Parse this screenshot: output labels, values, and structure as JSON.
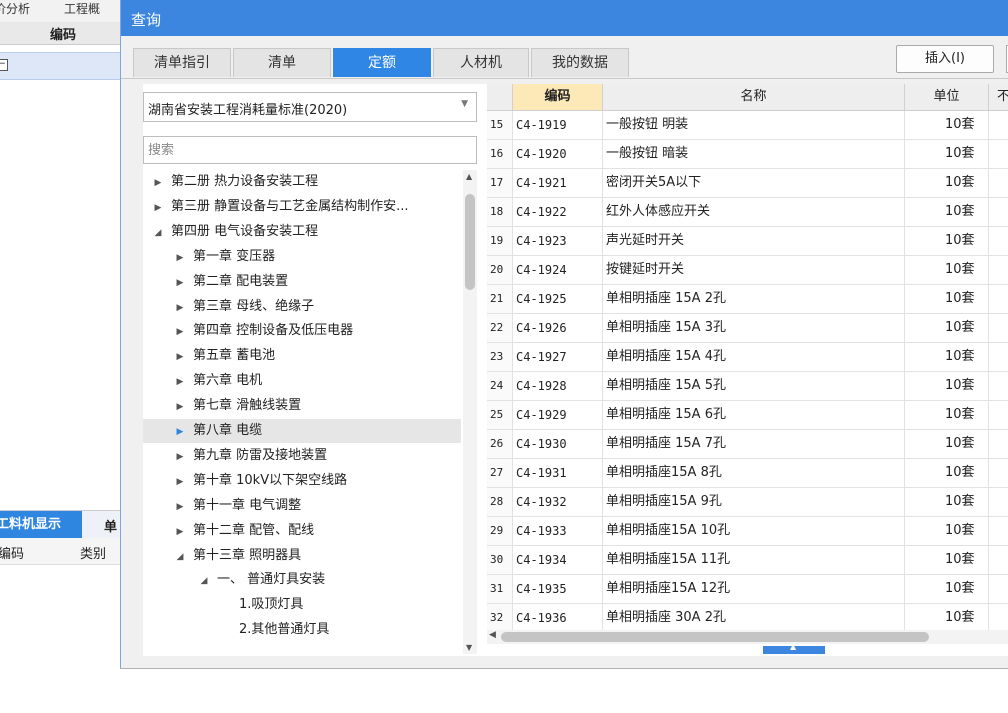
{
  "background_app": {
    "tabs": [
      "价分析",
      "工程概"
    ],
    "column_header": "编码",
    "bottom_tabs": [
      "工料机显示",
      "单"
    ],
    "bottom_columns": [
      "编码",
      "类别"
    ]
  },
  "dialog": {
    "title": "查询",
    "tabs": [
      {
        "label": "清单指引",
        "active": false
      },
      {
        "label": "清单",
        "active": false
      },
      {
        "label": "定额",
        "active": true
      },
      {
        "label": "人材机",
        "active": false
      },
      {
        "label": "我的数据",
        "active": false
      }
    ],
    "insert_button": "插入(I)",
    "standard_select": "湖南省安装工程消耗量标准(2020)",
    "search_placeholder": "搜索",
    "tree": [
      {
        "label": "第二册 热力设备安装工程",
        "level": 0,
        "expanded": false,
        "selected": false
      },
      {
        "label": "第三册 静置设备与工艺金属结构制作安...",
        "level": 0,
        "expanded": false,
        "selected": false
      },
      {
        "label": "第四册 电气设备安装工程",
        "level": 0,
        "expanded": true,
        "selected": false
      },
      {
        "label": "第一章 变压器",
        "level": 1,
        "expanded": false,
        "selected": false
      },
      {
        "label": "第二章 配电装置",
        "level": 1,
        "expanded": false,
        "selected": false
      },
      {
        "label": "第三章 母线、绝缘子",
        "level": 1,
        "expanded": false,
        "selected": false
      },
      {
        "label": "第四章 控制设备及低压电器",
        "level": 1,
        "expanded": false,
        "selected": false
      },
      {
        "label": "第五章 蓄电池",
        "level": 1,
        "expanded": false,
        "selected": false
      },
      {
        "label": "第六章 电机",
        "level": 1,
        "expanded": false,
        "selected": false
      },
      {
        "label": "第七章 滑触线装置",
        "level": 1,
        "expanded": false,
        "selected": false
      },
      {
        "label": "第八章 电缆",
        "level": 1,
        "expanded": false,
        "selected": true
      },
      {
        "label": "第九章 防雷及接地装置",
        "level": 1,
        "expanded": false,
        "selected": false
      },
      {
        "label": "第十章 10kV以下架空线路",
        "level": 1,
        "expanded": false,
        "selected": false
      },
      {
        "label": "第十一章 电气调整",
        "level": 1,
        "expanded": false,
        "selected": false
      },
      {
        "label": "第十二章 配管、配线",
        "level": 1,
        "expanded": false,
        "selected": false
      },
      {
        "label": "第十三章 照明器具",
        "level": 1,
        "expanded": true,
        "selected": false
      },
      {
        "label": "一、 普通灯具安装",
        "level": 2,
        "expanded": true,
        "selected": false
      },
      {
        "label": "1.吸顶灯具",
        "level": 3,
        "expanded": false,
        "selected": false
      },
      {
        "label": "2.其他普通灯具",
        "level": 3,
        "expanded": false,
        "selected": false
      }
    ],
    "grid": {
      "headers": {
        "code": "编码",
        "name": "名称",
        "unit": "单位",
        "extra": "不"
      },
      "rows": [
        {
          "idx": "15",
          "code": "C4-1919",
          "name": "一般按钮 明装",
          "unit": "10套"
        },
        {
          "idx": "16",
          "code": "C4-1920",
          "name": "一般按钮 暗装",
          "unit": "10套"
        },
        {
          "idx": "17",
          "code": "C4-1921",
          "name": "密闭开关5A以下",
          "unit": "10套"
        },
        {
          "idx": "18",
          "code": "C4-1922",
          "name": "红外人体感应开关",
          "unit": "10套"
        },
        {
          "idx": "19",
          "code": "C4-1923",
          "name": "声光延时开关",
          "unit": "10套"
        },
        {
          "idx": "20",
          "code": "C4-1924",
          "name": "按键延时开关",
          "unit": "10套"
        },
        {
          "idx": "21",
          "code": "C4-1925",
          "name": "单相明插座 15A 2孔",
          "unit": "10套"
        },
        {
          "idx": "22",
          "code": "C4-1926",
          "name": "单相明插座 15A 3孔",
          "unit": "10套"
        },
        {
          "idx": "23",
          "code": "C4-1927",
          "name": "单相明插座 15A 4孔",
          "unit": "10套"
        },
        {
          "idx": "24",
          "code": "C4-1928",
          "name": "单相明插座 15A 5孔",
          "unit": "10套"
        },
        {
          "idx": "25",
          "code": "C4-1929",
          "name": "单相明插座 15A 6孔",
          "unit": "10套"
        },
        {
          "idx": "26",
          "code": "C4-1930",
          "name": "单相明插座 15A 7孔",
          "unit": "10套"
        },
        {
          "idx": "27",
          "code": "C4-1931",
          "name": "单相明插座15A 8孔",
          "unit": "10套"
        },
        {
          "idx": "28",
          "code": "C4-1932",
          "name": "单相明插座15A 9孔",
          "unit": "10套"
        },
        {
          "idx": "29",
          "code": "C4-1933",
          "name": "单相明插座15A 10孔",
          "unit": "10套"
        },
        {
          "idx": "30",
          "code": "C4-1934",
          "name": "单相明插座15A 11孔",
          "unit": "10套"
        },
        {
          "idx": "31",
          "code": "C4-1935",
          "name": "单相明插座15A 12孔",
          "unit": "10套"
        },
        {
          "idx": "32",
          "code": "C4-1936",
          "name": "单相明插座 30A 2孔",
          "unit": "10套"
        }
      ]
    }
  },
  "colors": {
    "accent": "#2f86e4",
    "title_bar": "#3c86e0",
    "code_header": "#fde9b8"
  }
}
